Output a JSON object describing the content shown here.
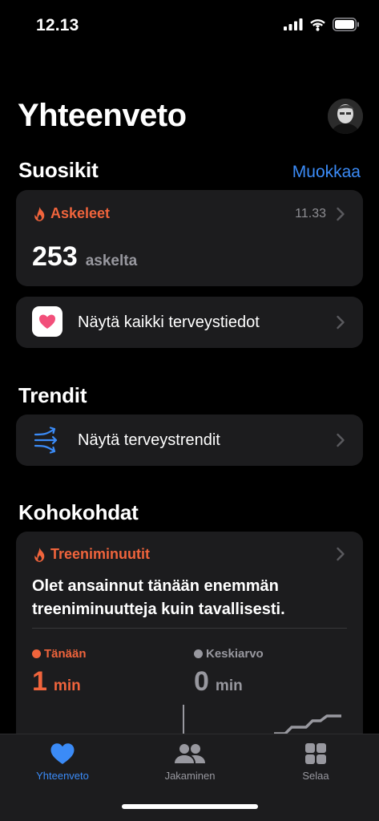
{
  "status": {
    "time": "12.13"
  },
  "header": {
    "title": "Yhteenveto"
  },
  "favorites": {
    "title": "Suosikit",
    "edit_label": "Muokkaa",
    "steps_card": {
      "title": "Askeleet",
      "time": "11.33",
      "value": "253",
      "unit": "askelta"
    },
    "all_health_label": "Näytä kaikki terveystiedot"
  },
  "trends": {
    "title": "Trendit",
    "show_trends_label": "Näytä terveystrendit"
  },
  "highlights": {
    "title": "Kohokohdat",
    "card": {
      "title": "Treeniminuutit",
      "text": "Olet ansainnut tänään enemmän treeniminuutteja kuin tavallisesti.",
      "today": {
        "label": "Tänään",
        "value": "1",
        "unit": "min"
      },
      "average": {
        "label": "Keskiarvo",
        "value": "0",
        "unit": "min"
      }
    }
  },
  "tab_bar": {
    "tabs": [
      {
        "label": "Yhteenveto",
        "icon": "heart-icon",
        "active": true
      },
      {
        "label": "Jakaminen",
        "icon": "people-icon",
        "active": false
      },
      {
        "label": "Selaa",
        "icon": "grid-icon",
        "active": false
      }
    ]
  },
  "colors": {
    "accent": "#3b8bf7",
    "activity": "#f0643c",
    "card": "#1c1c1e",
    "background": "#000000"
  }
}
